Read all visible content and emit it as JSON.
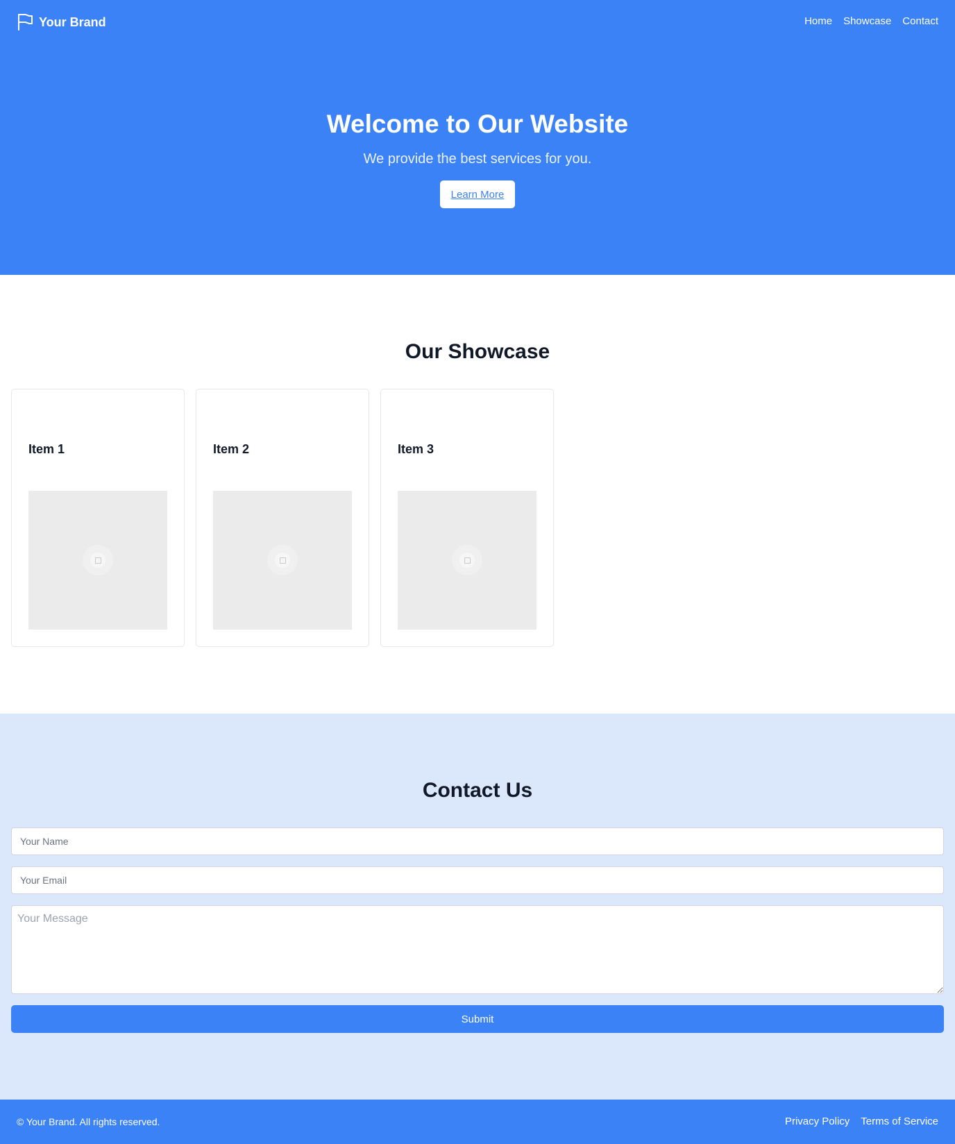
{
  "header": {
    "brand_name": "Your Brand",
    "brand_icon": "flag-icon",
    "nav": [
      "Home",
      "Showcase",
      "Contact"
    ]
  },
  "hero": {
    "title": "Welcome to Our Website",
    "subtitle": "We provide the best services for you.",
    "button_label": "Learn More"
  },
  "showcase": {
    "title": "Our Showcase",
    "items": [
      {
        "title": "Item 1",
        "image_icon": "image-placeholder-icon"
      },
      {
        "title": "Item 2",
        "image_icon": "image-placeholder-icon"
      },
      {
        "title": "Item 3",
        "image_icon": "image-placeholder-icon"
      }
    ]
  },
  "contact": {
    "title": "Contact Us",
    "name_placeholder": "Your Name",
    "email_placeholder": "Your Email",
    "message_placeholder": "Your Message",
    "submit_label": "Submit"
  },
  "footer": {
    "copyright": "© Your Brand. All rights reserved.",
    "links": [
      "Privacy Policy",
      "Terms of Service"
    ]
  },
  "colors": {
    "primary": "#3b82f6",
    "contact_bg": "#dbe8fc",
    "heading": "#111827"
  }
}
